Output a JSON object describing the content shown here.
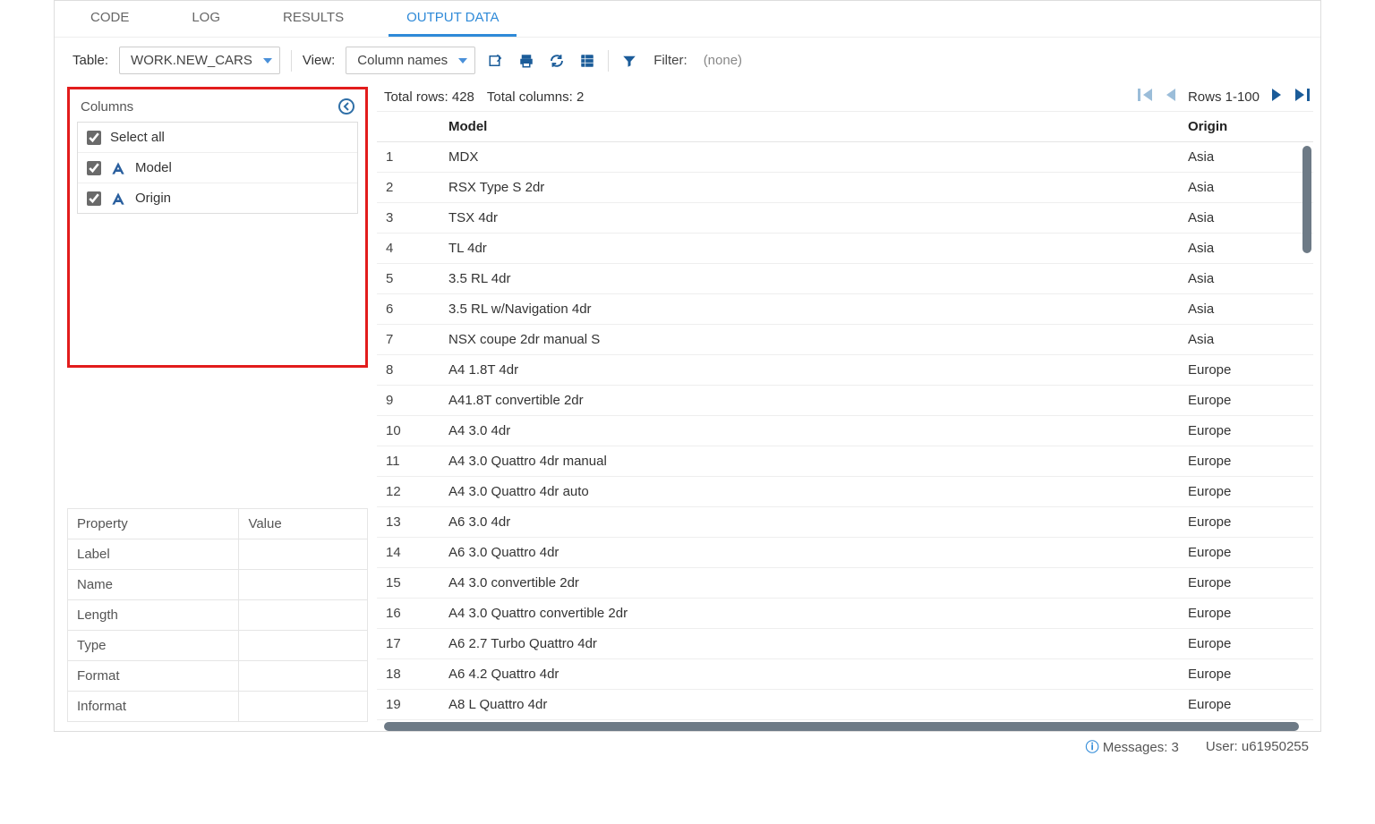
{
  "tabs": [
    "CODE",
    "LOG",
    "RESULTS",
    "OUTPUT DATA"
  ],
  "active_tab": 3,
  "toolbar": {
    "table_label": "Table:",
    "table_value": "WORK.NEW_CARS",
    "view_label": "View:",
    "view_value": "Column names",
    "filter_label": "Filter:",
    "filter_value": "(none)"
  },
  "columns_panel": {
    "title": "Columns",
    "select_all": "Select all",
    "items": [
      {
        "label": "Model",
        "checked": true
      },
      {
        "label": "Origin",
        "checked": true
      }
    ]
  },
  "properties": {
    "header_property": "Property",
    "header_value": "Value",
    "rows": [
      "Label",
      "Name",
      "Length",
      "Type",
      "Format",
      "Informat"
    ]
  },
  "meta": {
    "total_rows_label": "Total rows:",
    "total_rows_value": "428",
    "total_cols_label": "Total columns:",
    "total_cols_value": "2",
    "rows_range": "Rows 1-100"
  },
  "data": {
    "headers": [
      "",
      "Model",
      "Origin"
    ],
    "rows": [
      [
        "1",
        "MDX",
        "Asia"
      ],
      [
        "2",
        "RSX Type S 2dr",
        "Asia"
      ],
      [
        "3",
        "TSX 4dr",
        "Asia"
      ],
      [
        "4",
        "TL 4dr",
        "Asia"
      ],
      [
        "5",
        "3.5 RL 4dr",
        "Asia"
      ],
      [
        "6",
        "3.5 RL w/Navigation 4dr",
        "Asia"
      ],
      [
        "7",
        "NSX coupe 2dr manual S",
        "Asia"
      ],
      [
        "8",
        "A4 1.8T 4dr",
        "Europe"
      ],
      [
        "9",
        "A41.8T convertible 2dr",
        "Europe"
      ],
      [
        "10",
        "A4 3.0 4dr",
        "Europe"
      ],
      [
        "11",
        "A4 3.0 Quattro 4dr manual",
        "Europe"
      ],
      [
        "12",
        "A4 3.0 Quattro 4dr auto",
        "Europe"
      ],
      [
        "13",
        "A6 3.0 4dr",
        "Europe"
      ],
      [
        "14",
        "A6 3.0 Quattro 4dr",
        "Europe"
      ],
      [
        "15",
        "A4 3.0 convertible 2dr",
        "Europe"
      ],
      [
        "16",
        "A4 3.0 Quattro convertible 2dr",
        "Europe"
      ],
      [
        "17",
        "A6 2.7 Turbo Quattro 4dr",
        "Europe"
      ],
      [
        "18",
        "A6 4.2 Quattro 4dr",
        "Europe"
      ],
      [
        "19",
        "A8 L Quattro 4dr",
        "Europe"
      ]
    ]
  },
  "status": {
    "messages_label": "Messages:",
    "messages_count": "3",
    "user_label": "User:",
    "user_value": "u61950255"
  }
}
